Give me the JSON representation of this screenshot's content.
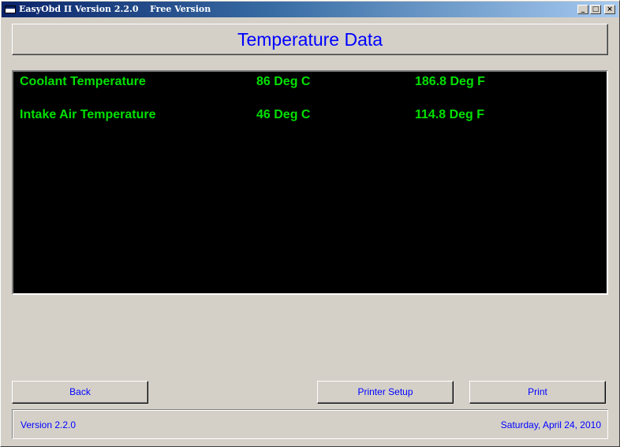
{
  "window": {
    "title": "EasyObd II Version 2.2.0",
    "subtitle": "Free Version",
    "controls": {
      "minimize_glyph": "_",
      "maximize_glyph": "□",
      "close_glyph": "×"
    }
  },
  "header": {
    "title": "Temperature Data"
  },
  "readings": [
    {
      "name": "Coolant Temperature",
      "celsius": "86 Deg C",
      "fahrenheit": "186.8 Deg F"
    },
    {
      "name": "Intake Air Temperature",
      "celsius": "46 Deg C",
      "fahrenheit": "114.8 Deg F"
    }
  ],
  "buttons": {
    "back": "Back",
    "printer_setup": "Printer Setup",
    "print": "Print"
  },
  "status": {
    "version": "Version 2.2.0",
    "date": "Saturday, April 24, 2010"
  },
  "colors": {
    "accent_text": "#0000ff",
    "reading_text": "#00e000",
    "data_background": "#000000",
    "window_background": "#d4d0c8"
  },
  "icons": {
    "app": "app-window-icon"
  }
}
